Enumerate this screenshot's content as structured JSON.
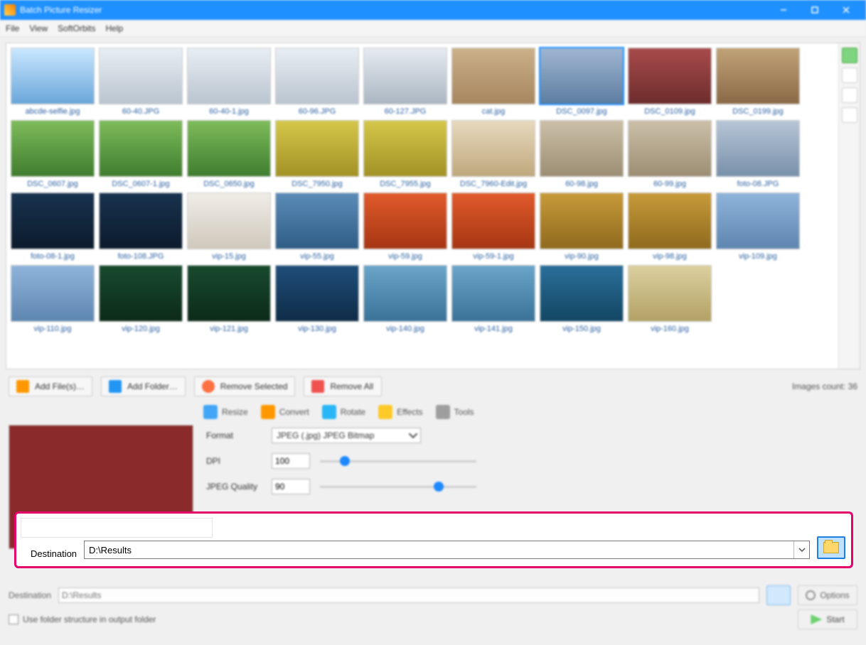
{
  "window": {
    "title": "Batch Picture Resizer"
  },
  "menu": {
    "file": "File",
    "view": "View",
    "softorbits": "SoftOrbits",
    "help": "Help"
  },
  "thumbs": [
    {
      "label": "abcde-selfie.jpg",
      "sel": false,
      "bg": "linear-gradient(#c9e7ff,#6aa6d9)"
    },
    {
      "label": "60-40.JPG",
      "sel": false,
      "bg": "linear-gradient(#e8eef4,#b9c4cf)"
    },
    {
      "label": "60-40-1.jpg",
      "sel": false,
      "bg": "linear-gradient(#e8eef4,#b9c4cf)"
    },
    {
      "label": "60-96.JPG",
      "sel": false,
      "bg": "linear-gradient(#e8eef4,#b9c4cf)"
    },
    {
      "label": "60-127.JPG",
      "sel": false,
      "bg": "linear-gradient(#e6ebf1,#aab6c2)"
    },
    {
      "label": "cat.jpg",
      "sel": false,
      "bg": "linear-gradient(#cbb08a,#a6865f)"
    },
    {
      "label": "DSC_0097.jpg",
      "sel": true,
      "bg": "linear-gradient(#9fb6d2,#5d7da0)"
    },
    {
      "label": "DSC_0109.jpg",
      "sel": false,
      "bg": "linear-gradient(#a84b4b,#6d2c2c)"
    },
    {
      "label": "DSC_0199.jpg",
      "sel": false,
      "bg": "linear-gradient(#c0a278,#8a6a46)"
    },
    {
      "label": "DSC_0607.jpg",
      "sel": false,
      "bg": "linear-gradient(#7dbb5a,#3f7d2f)"
    },
    {
      "label": "DSC_0607-1.jpg",
      "sel": false,
      "bg": "linear-gradient(#7dbb5a,#3f7d2f)"
    },
    {
      "label": "DSC_0650.jpg",
      "sel": false,
      "bg": "linear-gradient(#7dbb5a,#3f7d2f)"
    },
    {
      "label": "DSC_7950.jpg",
      "sel": false,
      "bg": "linear-gradient(#d4c74a,#a29125)"
    },
    {
      "label": "DSC_7955.jpg",
      "sel": false,
      "bg": "linear-gradient(#d4c74a,#a29125)"
    },
    {
      "label": "DSC_7960-Edit.jpg",
      "sel": false,
      "bg": "linear-gradient(#e7d9bd,#bfa87d)"
    },
    {
      "label": "60-98.jpg",
      "sel": false,
      "bg": "linear-gradient(#cbbfa7,#9c8e73)"
    },
    {
      "label": "60-99.jpg",
      "sel": false,
      "bg": "linear-gradient(#cbbfa7,#9c8e73)"
    },
    {
      "label": "foto-08.JPG",
      "sel": false,
      "bg": "linear-gradient(#b7c5d6,#7890aa)"
    },
    {
      "label": "foto-08-1.jpg",
      "sel": false,
      "bg": "linear-gradient(#18324f,#0c1b2c)"
    },
    {
      "label": "foto-108.JPG",
      "sel": false,
      "bg": "linear-gradient(#18324f,#0c1b2c)"
    },
    {
      "label": "vip-15.jpg",
      "sel": false,
      "bg": "linear-gradient(#f0ede7,#cfc8bb)"
    },
    {
      "label": "vip-55.jpg",
      "sel": false,
      "bg": "linear-gradient(#5a8bb7,#2f5d86)"
    },
    {
      "label": "vip-59.jpg",
      "sel": false,
      "bg": "linear-gradient(#e05a2b,#a63613)"
    },
    {
      "label": "vip-59-1.jpg",
      "sel": false,
      "bg": "linear-gradient(#e05a2b,#a63613)"
    },
    {
      "label": "vip-90.jpg",
      "sel": false,
      "bg": "linear-gradient(#c79a3a,#8f6a1e)"
    },
    {
      "label": "vip-98.jpg",
      "sel": false,
      "bg": "linear-gradient(#c79a3a,#8f6a1e)"
    },
    {
      "label": "vip-109.jpg",
      "sel": false,
      "bg": "linear-gradient(#8fb4da,#5d86b0)"
    },
    {
      "label": "vip-110.jpg",
      "sel": false,
      "bg": "linear-gradient(#8fb4da,#5d86b0)"
    },
    {
      "label": "vip-120.jpg",
      "sel": false,
      "bg": "linear-gradient(#184a2e,#0c2a19)"
    },
    {
      "label": "vip-121.jpg",
      "sel": false,
      "bg": "linear-gradient(#184a2e,#0c2a19)"
    },
    {
      "label": "vip-130.jpg",
      "sel": false,
      "bg": "linear-gradient(#1f4e7a,#0f2c47)"
    },
    {
      "label": "vip-140.jpg",
      "sel": false,
      "bg": "linear-gradient(#6aa6c9,#3a7297)"
    },
    {
      "label": "vip-141.jpg",
      "sel": false,
      "bg": "linear-gradient(#6aa6c9,#3a7297)"
    },
    {
      "label": "vip-150.jpg",
      "sel": false,
      "bg": "linear-gradient(#2a6f9a,#134663)"
    },
    {
      "label": "vip-160.jpg",
      "sel": false,
      "bg": "linear-gradient(#dcd0a0,#b1a164)"
    }
  ],
  "toolbar": {
    "add_files": "Add File(s)…",
    "add_folder": "Add Folder…",
    "remove_selected": "Remove Selected",
    "remove_all": "Remove All",
    "count_label": "Images count: 36"
  },
  "tabs": {
    "resize": "Resize",
    "convert": "Convert",
    "rotate": "Rotate",
    "effects": "Effects",
    "tools": "Tools"
  },
  "settings": {
    "format_label": "Format",
    "format_value": "JPEG (.jpg) JPEG Bitmap",
    "dpi_label": "DPI",
    "dpi_value": "100",
    "quality_label": "JPEG Quality",
    "quality_value": "90"
  },
  "callout": {
    "dest_label": "Destination",
    "dest_value": "D:\\Results"
  },
  "bottom": {
    "dest_label": "Destination",
    "dest_value": "D:\\Results",
    "options": "Options",
    "checkbox": "Use folder structure in output folder",
    "start": "Start"
  }
}
